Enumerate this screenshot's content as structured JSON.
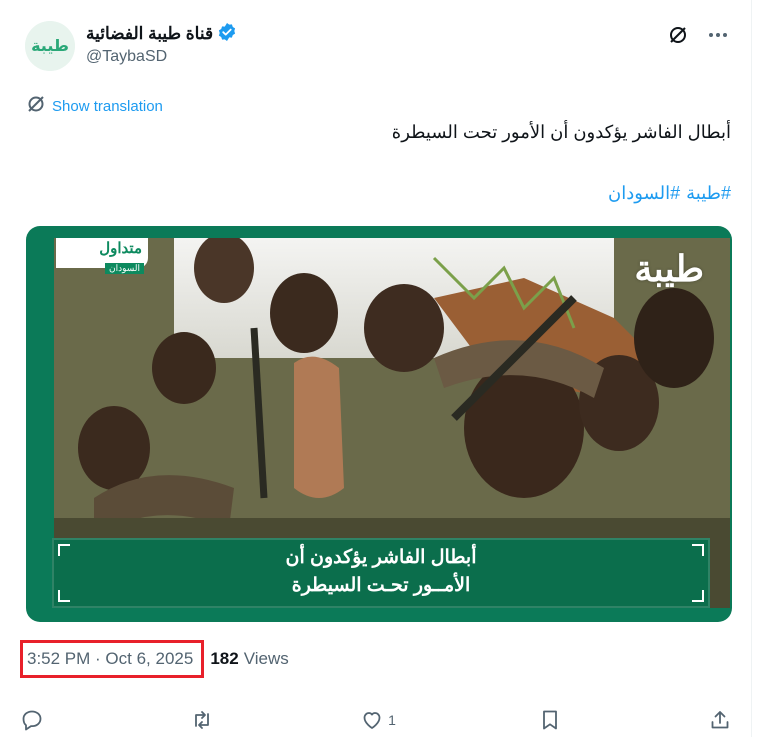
{
  "author": {
    "display_name": "قناة طيبة الفضائية",
    "handle": "@TaybaSD",
    "avatar_logo_text": "طيبة",
    "verified": true
  },
  "header": {
    "grok_icon": "slash-circle-icon",
    "more_icon": "more-dots-icon"
  },
  "translation": {
    "label": "Show translation"
  },
  "post": {
    "text": "أبطال الفاشر يؤكدون أن الأمور تحت السيطرة",
    "hashtags": [
      "#طيبة",
      "#السودان"
    ]
  },
  "media": {
    "trend_badge_main": "متداول",
    "trend_badge_sub": "السودان",
    "watermark": "طيبة",
    "caption_line1": "أبطال الفاشر يؤكدون أن",
    "caption_line2": "الأمــور تحـت السيطرة"
  },
  "meta": {
    "timestamp": "3:52 PM · Oct 6, 2025",
    "views_count": "182",
    "views_label": "Views"
  },
  "actions": {
    "reply_count": "",
    "repost_count": "",
    "like_count": "1",
    "bookmark_count": ""
  },
  "colors": {
    "accent": "#1d9bf0",
    "brand_green": "#0b7a58",
    "highlight_red": "#e8202a"
  }
}
